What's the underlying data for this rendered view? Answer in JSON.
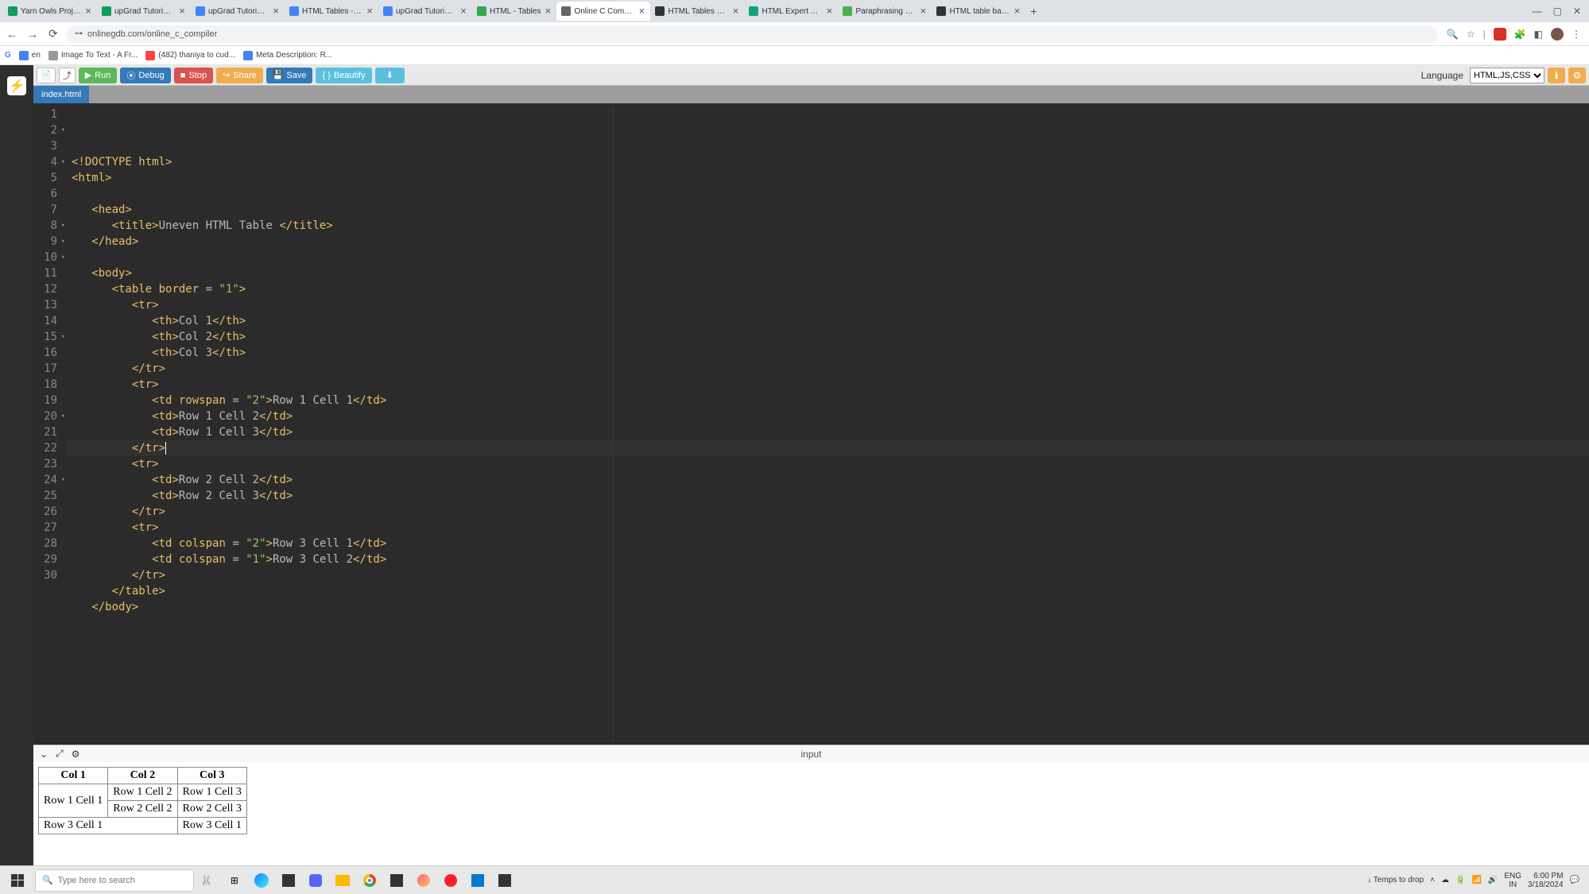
{
  "browser": {
    "tabs": [
      {
        "title": "Yarn Owls Projects - Goog",
        "favicon": "#0f9d58"
      },
      {
        "title": "upGrad Tutorials - Googl",
        "favicon": "#0f9d58"
      },
      {
        "title": "upGrad Tutorials: The Ult",
        "favicon": "#4285f4"
      },
      {
        "title": "HTML Tables - Google Do",
        "favicon": "#4285f4"
      },
      {
        "title": "upGrad Tutorial_HTML Ta",
        "favicon": "#4285f4"
      },
      {
        "title": "HTML - Tables",
        "favicon": "#34a853"
      },
      {
        "title": "Online C Compiler - onlin",
        "favicon": "#666"
      },
      {
        "title": "HTML Tables – Table Tuto",
        "favicon": "#333"
      },
      {
        "title": "HTML Expert Advice",
        "favicon": "#10a37f"
      },
      {
        "title": "Paraphrasing Tool - Quill",
        "favicon": "#4caf50"
      },
      {
        "title": "HTML table basics - Lear",
        "favicon": "#333"
      }
    ],
    "active_tab_index": 6,
    "url": "onlinegdb.com/online_c_compiler",
    "bookmarks": [
      {
        "label": "en",
        "icon": "#4285f4"
      },
      {
        "label": "Image To Text - A Fr...",
        "icon": "#999"
      },
      {
        "label": "(482) thaniya to cud...",
        "icon": "#ff4444"
      },
      {
        "label": "Meta Description: R...",
        "icon": "#4285f4"
      }
    ]
  },
  "app": {
    "toolbar": {
      "run": "Run",
      "debug": "Debug",
      "stop": "Stop",
      "share": "Share",
      "save": "Save",
      "beautify": "Beautify",
      "language_label": "Language",
      "language_value": "HTML,JS,CSS"
    },
    "file_tab": "index.html",
    "code_lines": [
      {
        "n": 1,
        "html": "<span class='tok-doctype'>&lt;!DOCTYPE html&gt;</span>"
      },
      {
        "n": 2,
        "fold": true,
        "html": "<span class='tok-tag'>&lt;html&gt;</span>"
      },
      {
        "n": 3,
        "html": ""
      },
      {
        "n": 4,
        "fold": true,
        "html": "   <span class='tok-tag'>&lt;head&gt;</span>"
      },
      {
        "n": 5,
        "html": "      <span class='tok-tag'>&lt;title&gt;</span><span class='tok-txt'>Uneven HTML Table </span><span class='tok-tag'>&lt;/title&gt;</span>"
      },
      {
        "n": 6,
        "html": "   <span class='tok-tag'>&lt;/head&gt;</span>"
      },
      {
        "n": 7,
        "html": ""
      },
      {
        "n": 8,
        "fold": true,
        "html": "   <span class='tok-tag'>&lt;body&gt;</span>"
      },
      {
        "n": 9,
        "fold": true,
        "html": "      <span class='tok-tag'>&lt;table</span> <span class='tok-attr'>border</span> <span class='tok-eq'>=</span> <span class='tok-str'>\"1\"</span><span class='tok-tag'>&gt;</span>"
      },
      {
        "n": 10,
        "fold": true,
        "html": "         <span class='tok-tag'>&lt;tr&gt;</span>"
      },
      {
        "n": 11,
        "html": "            <span class='tok-tag'>&lt;th&gt;</span><span class='tok-txt'>Col 1</span><span class='tok-tag'>&lt;/th&gt;</span>"
      },
      {
        "n": 12,
        "html": "            <span class='tok-tag'>&lt;th&gt;</span><span class='tok-txt'>Col 2</span><span class='tok-tag'>&lt;/th&gt;</span>"
      },
      {
        "n": 13,
        "html": "            <span class='tok-tag'>&lt;th&gt;</span><span class='tok-txt'>Col 3</span><span class='tok-tag'>&lt;/th&gt;</span>"
      },
      {
        "n": 14,
        "html": "         <span class='tok-tag'>&lt;/tr&gt;</span>"
      },
      {
        "n": 15,
        "fold": true,
        "html": "         <span class='tok-tag'>&lt;tr&gt;</span>"
      },
      {
        "n": 16,
        "html": "            <span class='tok-tag'>&lt;td</span> <span class='tok-attr'>rowspan</span> <span class='tok-eq'>=</span> <span class='tok-str'>\"2\"</span><span class='tok-tag'>&gt;</span><span class='tok-txt'>Row 1 Cell 1</span><span class='tok-tag'>&lt;/td&gt;</span>"
      },
      {
        "n": 17,
        "html": "            <span class='tok-tag'>&lt;td&gt;</span><span class='tok-txt'>Row 1 Cell 2</span><span class='tok-tag'>&lt;/td&gt;</span>"
      },
      {
        "n": 18,
        "html": "            <span class='tok-tag'>&lt;td&gt;</span><span class='tok-txt'>Row 1 Cell 3</span><span class='tok-tag'>&lt;/td&gt;</span>"
      },
      {
        "n": 19,
        "active": true,
        "html": "         <span class='tok-tag'>&lt;/tr&gt;</span><span class='cursor-mark'></span>"
      },
      {
        "n": 20,
        "fold": true,
        "html": "         <span class='tok-tag'>&lt;tr&gt;</span>"
      },
      {
        "n": 21,
        "html": "            <span class='tok-tag'>&lt;td&gt;</span><span class='tok-txt'>Row 2 Cell 2</span><span class='tok-tag'>&lt;/td&gt;</span>"
      },
      {
        "n": 22,
        "html": "            <span class='tok-tag'>&lt;td&gt;</span><span class='tok-txt'>Row 2 Cell 3</span><span class='tok-tag'>&lt;/td&gt;</span>"
      },
      {
        "n": 23,
        "html": "         <span class='tok-tag'>&lt;/tr&gt;</span>"
      },
      {
        "n": 24,
        "fold": true,
        "html": "         <span class='tok-tag'>&lt;tr&gt;</span>"
      },
      {
        "n": 25,
        "html": "            <span class='tok-tag'>&lt;td</span> <span class='tok-attr'>colspan</span> <span class='tok-eq'>=</span> <span class='tok-str'>\"2\"</span><span class='tok-tag'>&gt;</span><span class='tok-txt'>Row 3 Cell 1</span><span class='tok-tag'>&lt;/td&gt;</span>"
      },
      {
        "n": 26,
        "html": "            <span class='tok-tag'>&lt;td</span> <span class='tok-attr'>colspan</span> <span class='tok-eq'>=</span> <span class='tok-str'>\"1\"</span><span class='tok-tag'>&gt;</span><span class='tok-txt'>Row 3 Cell 2</span><span class='tok-tag'>&lt;/td&gt;</span>"
      },
      {
        "n": 27,
        "html": "         <span class='tok-tag'>&lt;/tr&gt;</span>"
      },
      {
        "n": 28,
        "html": "      <span class='tok-tag'>&lt;/table&gt;</span>"
      },
      {
        "n": 29,
        "html": "   <span class='tok-tag'>&lt;/body&gt;</span>"
      },
      {
        "n": 30,
        "html": ""
      }
    ],
    "output_label": "input",
    "output_table": {
      "headers": [
        "Col 1",
        "Col 2",
        "Col 3"
      ],
      "rows": [
        [
          {
            "text": "Row 1 Cell 1",
            "rowspan": 2
          },
          {
            "text": "Row 1 Cell 2"
          },
          {
            "text": "Row 1 Cell 3"
          }
        ],
        [
          {
            "text": "Row 2 Cell 2"
          },
          {
            "text": "Row 2 Cell 3"
          }
        ],
        [
          {
            "text": "Row 3 Cell 1",
            "colspan": 2
          },
          {
            "text": "Row 3 Cell 1"
          }
        ]
      ]
    }
  },
  "taskbar": {
    "search_placeholder": "Type here to search",
    "weather": "Temps to drop",
    "lang": "ENG",
    "lang2": "IN",
    "time": "6:00 PM",
    "date": "3/18/2024"
  }
}
